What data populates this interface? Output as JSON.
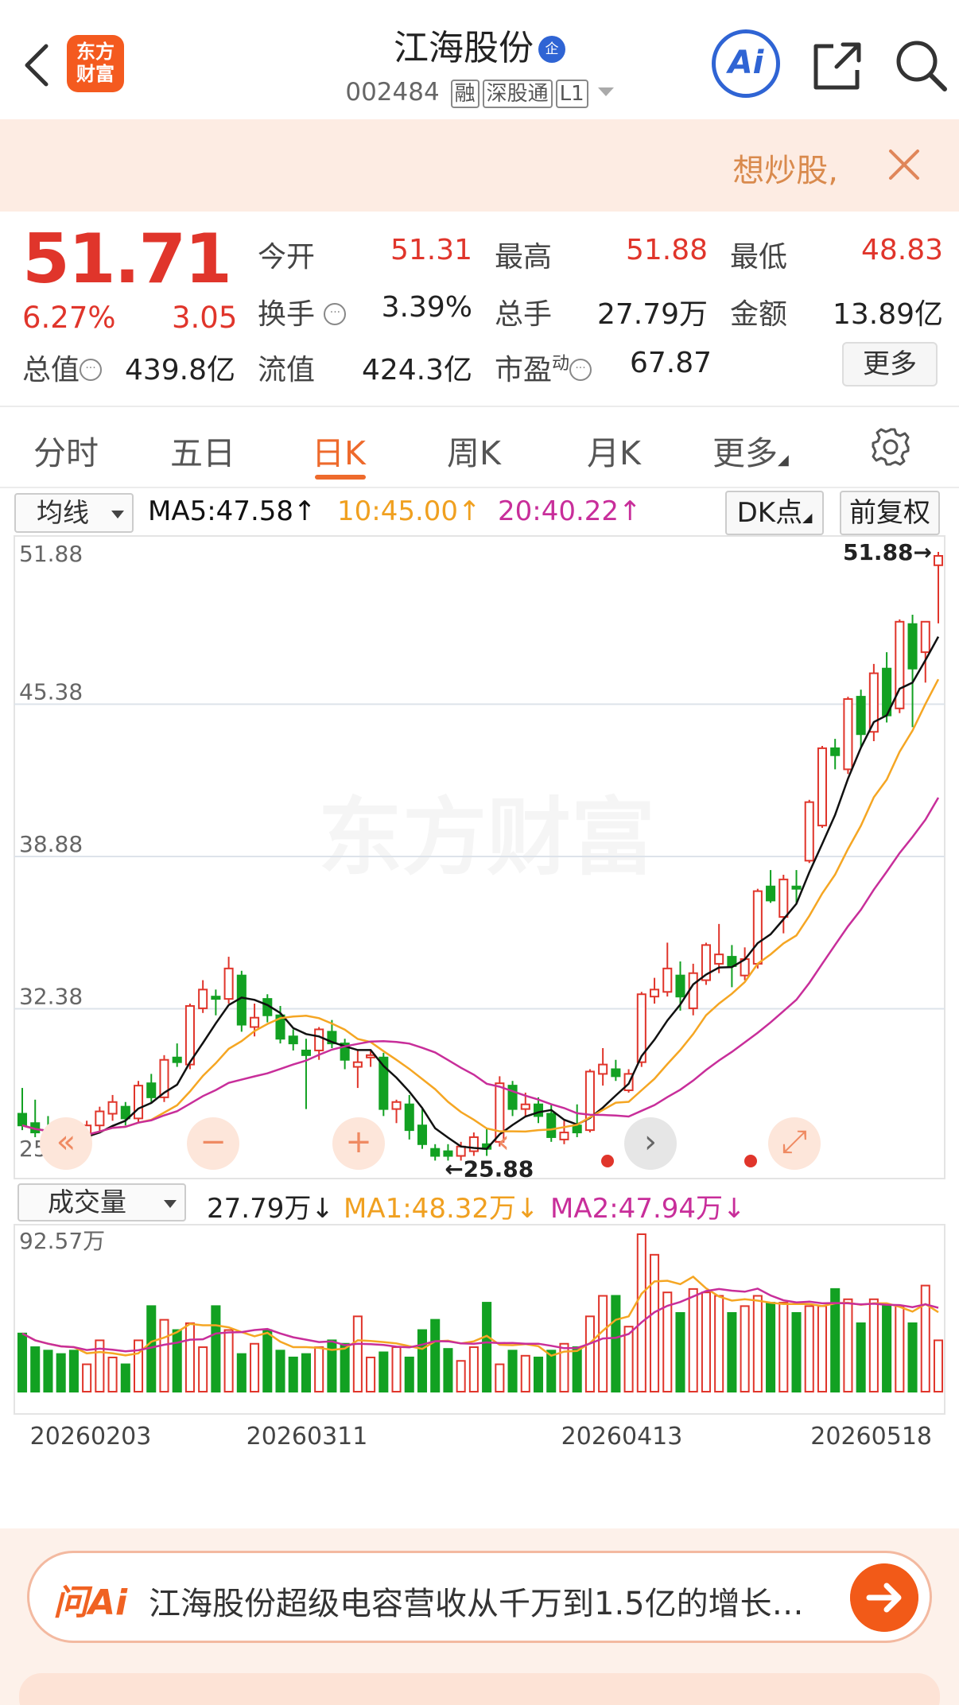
{
  "header": {
    "logo_text": "东方财富",
    "title": "江海股份",
    "title_badge": "企",
    "code": "002484",
    "tags": [
      "融",
      "深股通",
      "L1"
    ],
    "ai_label": "Ai"
  },
  "banner": {
    "text": "想炒股,"
  },
  "quote": {
    "price": "51.71",
    "change_pct": "6.27%",
    "change": "3.05",
    "rows": [
      [
        {
          "label": "今开",
          "value": "51.31"
        },
        {
          "label": "最高",
          "value": "51.88"
        },
        {
          "label": "最低",
          "value": "48.83"
        }
      ],
      [
        {
          "label": "换手",
          "value": "3.39%"
        },
        {
          "label": "总手",
          "value": "27.79万"
        },
        {
          "label": "金额",
          "value": "13.89亿"
        }
      ],
      [
        {
          "label": "总值",
          "value": "439.8亿"
        },
        {
          "label": "流值",
          "value": "424.3亿"
        },
        {
          "label": "市盈",
          "sup": "动",
          "value": "67.87"
        }
      ]
    ],
    "more_label": "更多",
    "dots_glyph": "···"
  },
  "tabs": [
    "分时",
    "五日",
    "日K",
    "周K",
    "月K",
    "更多"
  ],
  "active_tab": "日K",
  "kline_header": {
    "indicator": "均线",
    "ma5": "MA5:47.58",
    "ma10": "10:45.00",
    "ma20": "20:40.22",
    "up_arrow": "↑",
    "dk_label": "DK点",
    "adjust_label": "前复权"
  },
  "colors": {
    "up": "#e0352b",
    "down": "#12a122",
    "ma5": "#111111",
    "ma10": "#f5a623",
    "ma20": "#c82e9a",
    "accent": "#ee6a2c"
  },
  "chart_data": {
    "type": "candlestick",
    "y_ticks": [
      "51.88",
      "45.38",
      "38.88",
      "32.38",
      "25.88"
    ],
    "ylim": [
      25.88,
      51.88
    ],
    "max_label": "51.88",
    "min_label": "25.88",
    "x_labels": [
      "20260203",
      "20260311",
      "20260413",
      "20260518"
    ],
    "ohlc": [
      [
        27.9,
        29.0,
        27.2,
        27.4
      ],
      [
        27.5,
        28.5,
        26.9,
        27.1
      ],
      [
        27.1,
        27.8,
        26.6,
        27.0
      ],
      [
        26.9,
        27.4,
        26.2,
        26.6
      ],
      [
        26.7,
        27.2,
        26.3,
        26.5
      ],
      [
        26.6,
        27.6,
        26.4,
        27.4
      ],
      [
        27.4,
        28.2,
        27.1,
        28.0
      ],
      [
        27.9,
        28.7,
        27.6,
        28.4
      ],
      [
        28.2,
        28.4,
        27.4,
        27.7
      ],
      [
        27.7,
        29.3,
        27.5,
        29.1
      ],
      [
        29.2,
        29.6,
        28.4,
        28.6
      ],
      [
        28.6,
        30.4,
        28.4,
        30.2
      ],
      [
        30.3,
        30.9,
        29.9,
        30.1
      ],
      [
        30.0,
        32.6,
        29.8,
        32.5
      ],
      [
        32.4,
        33.6,
        32.2,
        33.2
      ],
      [
        32.9,
        33.2,
        32.1,
        32.8
      ],
      [
        32.8,
        34.6,
        32.6,
        34.1
      ],
      [
        33.8,
        34.0,
        31.4,
        31.7
      ],
      [
        31.6,
        32.6,
        31.2,
        32.0
      ],
      [
        32.8,
        33.0,
        31.8,
        32.1
      ],
      [
        32.1,
        32.5,
        30.9,
        31.1
      ],
      [
        31.2,
        31.5,
        30.6,
        30.9
      ],
      [
        30.6,
        31.1,
        28.1,
        30.4
      ],
      [
        30.6,
        31.6,
        30.2,
        31.5
      ],
      [
        31.4,
        31.9,
        30.7,
        30.9
      ],
      [
        30.9,
        31.1,
        29.8,
        30.2
      ],
      [
        29.9,
        30.6,
        29.0,
        30.1
      ],
      [
        30.3,
        30.6,
        29.9,
        30.4
      ],
      [
        30.3,
        30.5,
        27.8,
        28.1
      ],
      [
        28.1,
        28.5,
        27.5,
        28.4
      ],
      [
        28.3,
        28.7,
        26.8,
        27.2
      ],
      [
        27.4,
        28.1,
        26.4,
        26.6
      ],
      [
        26.4,
        26.6,
        25.9,
        26.1
      ],
      [
        26.3,
        26.6,
        25.9,
        26.1
      ],
      [
        26.1,
        26.7,
        25.9,
        26.5
      ],
      [
        26.3,
        27.1,
        26.1,
        26.9
      ],
      [
        26.6,
        27.3,
        26.1,
        26.4
      ],
      [
        26.7,
        29.5,
        26.5,
        29.2
      ],
      [
        29.1,
        29.3,
        27.8,
        28.1
      ],
      [
        28.1,
        28.8,
        27.8,
        28.3
      ],
      [
        28.3,
        28.6,
        27.5,
        27.8
      ],
      [
        27.9,
        28.3,
        26.7,
        26.9
      ],
      [
        26.8,
        27.6,
        26.6,
        27.1
      ],
      [
        27.4,
        28.3,
        26.9,
        27.1
      ],
      [
        27.2,
        29.8,
        27.1,
        29.7
      ],
      [
        29.6,
        30.7,
        29.1,
        30.0
      ],
      [
        29.8,
        30.2,
        29.3,
        29.5
      ],
      [
        28.9,
        29.8,
        28.8,
        29.6
      ],
      [
        30.1,
        33.1,
        29.9,
        33.0
      ],
      [
        32.9,
        33.7,
        32.6,
        33.2
      ],
      [
        33.1,
        35.2,
        32.9,
        34.1
      ],
      [
        33.8,
        34.4,
        32.3,
        32.9
      ],
      [
        32.4,
        34.3,
        32.1,
        33.9
      ],
      [
        33.6,
        35.2,
        33.4,
        35.1
      ],
      [
        34.3,
        36.0,
        33.9,
        34.7
      ],
      [
        34.6,
        35.1,
        33.3,
        34.2
      ],
      [
        33.8,
        35.0,
        33.6,
        34.5
      ],
      [
        34.3,
        37.5,
        34.1,
        37.4
      ],
      [
        37.6,
        38.3,
        36.9,
        37.0
      ],
      [
        36.3,
        38.1,
        35.6,
        37.9
      ],
      [
        37.6,
        38.3,
        36.9,
        37.5
      ],
      [
        38.7,
        41.3,
        38.6,
        41.2
      ],
      [
        40.2,
        43.6,
        40.1,
        43.5
      ],
      [
        43.5,
        43.9,
        42.6,
        43.2
      ],
      [
        42.6,
        45.7,
        42.4,
        45.6
      ],
      [
        45.7,
        46.0,
        43.5,
        44.1
      ],
      [
        44.2,
        47.1,
        43.8,
        46.7
      ],
      [
        46.9,
        47.6,
        44.6,
        44.9
      ],
      [
        45.2,
        49.0,
        45.0,
        48.9
      ],
      [
        48.8,
        49.2,
        44.4,
        46.9
      ],
      [
        47.6,
        48.9,
        46.3,
        48.9
      ],
      [
        51.31,
        51.88,
        48.83,
        51.71
      ]
    ],
    "volume_header": {
      "indicator": "成交量",
      "vol": "27.79万",
      "ma1": "MA1:48.32万",
      "ma2": "MA2:47.94万",
      "down_arrow": "↓",
      "max_label": "92.57万"
    },
    "volume": [
      34,
      26,
      24,
      22,
      24,
      16,
      30,
      20,
      16,
      30,
      50,
      42,
      36,
      40,
      26,
      50,
      36,
      22,
      28,
      36,
      24,
      20,
      22,
      26,
      30,
      28,
      44,
      20,
      23,
      26,
      20,
      36,
      42,
      25,
      18,
      26,
      52,
      16,
      24,
      21,
      20,
      24,
      28,
      26,
      44,
      56,
      56,
      38,
      92,
      80,
      58,
      46,
      60,
      58,
      56,
      46,
      50,
      56,
      52,
      52,
      46,
      50,
      50,
      60,
      54,
      40,
      54,
      50,
      50,
      40,
      62,
      30
    ]
  },
  "chart_controls": [
    "«",
    "−",
    "+",
    "‹",
    "›",
    "⤢"
  ],
  "ai_bar": {
    "logo": "问Ai",
    "question": "江海股份超级电容营收从千万到1.5亿的增长…"
  }
}
